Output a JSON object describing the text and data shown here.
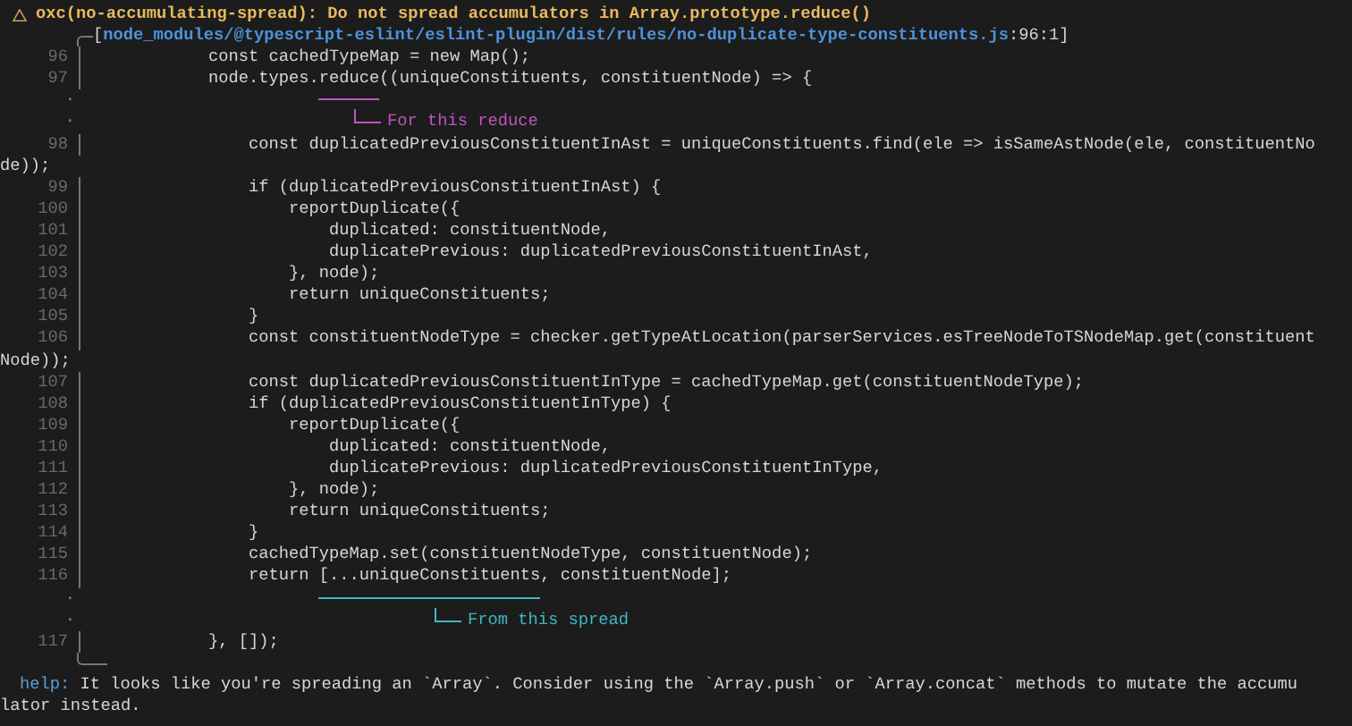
{
  "diagnostic": {
    "title": "oxc(no-accumulating-spread): Do not spread accumulators in Array.prototype.reduce()",
    "source": {
      "open": "[",
      "file": "node_modules/@typescript-eslint/eslint-plugin/dist/rules/no-duplicate-type-constituents.js",
      "location": ":96:1]"
    },
    "rows": [
      {
        "kind": "code",
        "number": "96",
        "text": "            const cachedTypeMap = new Map();"
      },
      {
        "kind": "code",
        "number": "97",
        "text": "            node.types.reduce((uniqueConstituents, constituentNode) => {"
      },
      {
        "kind": "underline",
        "marker": "·",
        "color": "#c154c1"
      },
      {
        "kind": "label",
        "marker": "·",
        "label": "For this reduce",
        "color": "#c154c1"
      },
      {
        "kind": "code",
        "number": "98",
        "text": "                const duplicatedPreviousConstituentInAst = uniqueConstituents.find(ele => isSameAstNode(ele, constituentNo"
      },
      {
        "kind": "wrap",
        "text": "de));"
      },
      {
        "kind": "code",
        "number": "99",
        "text": "                if (duplicatedPreviousConstituentInAst) {"
      },
      {
        "kind": "code",
        "number": "100",
        "text": "                    reportDuplicate({"
      },
      {
        "kind": "code",
        "number": "101",
        "text": "                        duplicated: constituentNode,"
      },
      {
        "kind": "code",
        "number": "102",
        "text": "                        duplicatePrevious: duplicatedPreviousConstituentInAst,"
      },
      {
        "kind": "code",
        "number": "103",
        "text": "                    }, node);"
      },
      {
        "kind": "code",
        "number": "104",
        "text": "                    return uniqueConstituents;"
      },
      {
        "kind": "code",
        "number": "105",
        "text": "                }"
      },
      {
        "kind": "code",
        "number": "106",
        "text": "                const constituentNodeType = checker.getTypeAtLocation(parserServices.esTreeNodeToTSNodeMap.get(constituent"
      },
      {
        "kind": "wrap",
        "text": "Node));"
      },
      {
        "kind": "code",
        "number": "107",
        "text": "                const duplicatedPreviousConstituentInType = cachedTypeMap.get(constituentNodeType);"
      },
      {
        "kind": "code",
        "number": "108",
        "text": "                if (duplicatedPreviousConstituentInType) {"
      },
      {
        "kind": "code",
        "number": "109",
        "text": "                    reportDuplicate({"
      },
      {
        "kind": "code",
        "number": "110",
        "text": "                        duplicated: constituentNode,"
      },
      {
        "kind": "code",
        "number": "111",
        "text": "                        duplicatePrevious: duplicatedPreviousConstituentInType,"
      },
      {
        "kind": "code",
        "number": "112",
        "text": "                    }, node);"
      },
      {
        "kind": "code",
        "number": "113",
        "text": "                    return uniqueConstituents;"
      },
      {
        "kind": "code",
        "number": "114",
        "text": "                }"
      },
      {
        "kind": "code",
        "number": "115",
        "text": "                cachedTypeMap.set(constituentNodeType, constituentNode);"
      },
      {
        "kind": "code",
        "number": "116",
        "text": "                return [...uniqueConstituents, constituentNode];"
      },
      {
        "kind": "underline",
        "marker": "·",
        "color": "#3fb8c4"
      },
      {
        "kind": "label",
        "marker": "·",
        "label": "From this spread",
        "color": "#3fb8c4"
      },
      {
        "kind": "code",
        "number": "117",
        "text": "            }, []);"
      },
      {
        "kind": "end"
      },
      {
        "kind": "help",
        "label": "help:",
        "text": " It looks like you're spreading an `Array`. Consider using the `Array.push` or `Array.concat` methods to mutate the accumu"
      },
      {
        "kind": "wrap",
        "text": "lator instead."
      }
    ]
  }
}
